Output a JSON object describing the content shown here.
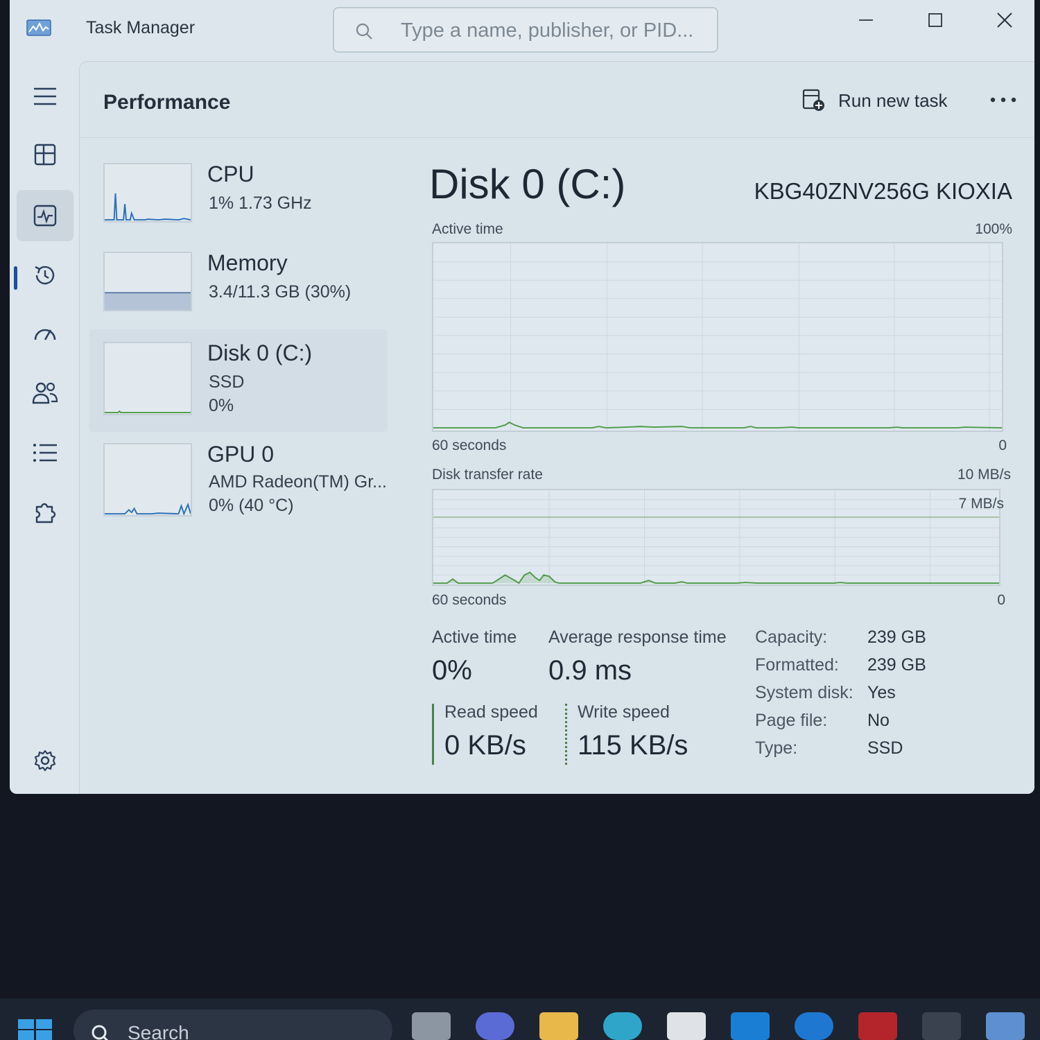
{
  "window": {
    "title": "Task Manager",
    "search_placeholder": "Type a name, publisher, or PID..."
  },
  "header": {
    "title": "Performance",
    "run_new_task": "Run new task"
  },
  "nav": {
    "items": [
      "hamburger-menu",
      "processes",
      "performance",
      "app-history",
      "startup-apps",
      "users",
      "details",
      "services",
      "settings"
    ],
    "active": "performance"
  },
  "devices": [
    {
      "name": "CPU",
      "line1": "1%  1.73 GHz"
    },
    {
      "name": "Memory",
      "line1": "3.4/11.3 GB (30%)"
    },
    {
      "name": "Disk 0 (C:)",
      "line1": "SSD",
      "line2": "0%"
    },
    {
      "name": "GPU 0",
      "line1": "AMD Radeon(TM) Gr...",
      "line2": "0%  (40 °C)"
    }
  ],
  "detail": {
    "title": "Disk 0 (C:)",
    "model": "KBG40ZNV256G KIOXIA",
    "active_graph": {
      "label": "Active time",
      "max": "100%",
      "time": "60 seconds",
      "min": "0"
    },
    "transfer_graph": {
      "label": "Disk transfer rate",
      "max": "10 MB/s",
      "marker": "7 MB/s",
      "time": "60 seconds",
      "min": "0"
    },
    "stats": {
      "active_time_label": "Active time",
      "active_time_value": "0%",
      "avg_response_label": "Average response time",
      "avg_response_value": "0.9 ms",
      "read_label": "Read speed",
      "read_value": "0 KB/s",
      "write_label": "Write speed",
      "write_value": "115 KB/s"
    },
    "properties": [
      {
        "label": "Capacity:",
        "value": "239 GB"
      },
      {
        "label": "Formatted:",
        "value": "239 GB"
      },
      {
        "label": "System disk:",
        "value": "Yes"
      },
      {
        "label": "Page file:",
        "value": "No"
      },
      {
        "label": "Type:",
        "value": "SSD"
      }
    ]
  },
  "taskbar": {
    "search_label": "Search"
  },
  "colors": {
    "window_bg": "#dce6ec",
    "accent": "#1d4f9a",
    "disk_graph_line": "#4f9a4a",
    "desktop_bg": "#131722"
  }
}
